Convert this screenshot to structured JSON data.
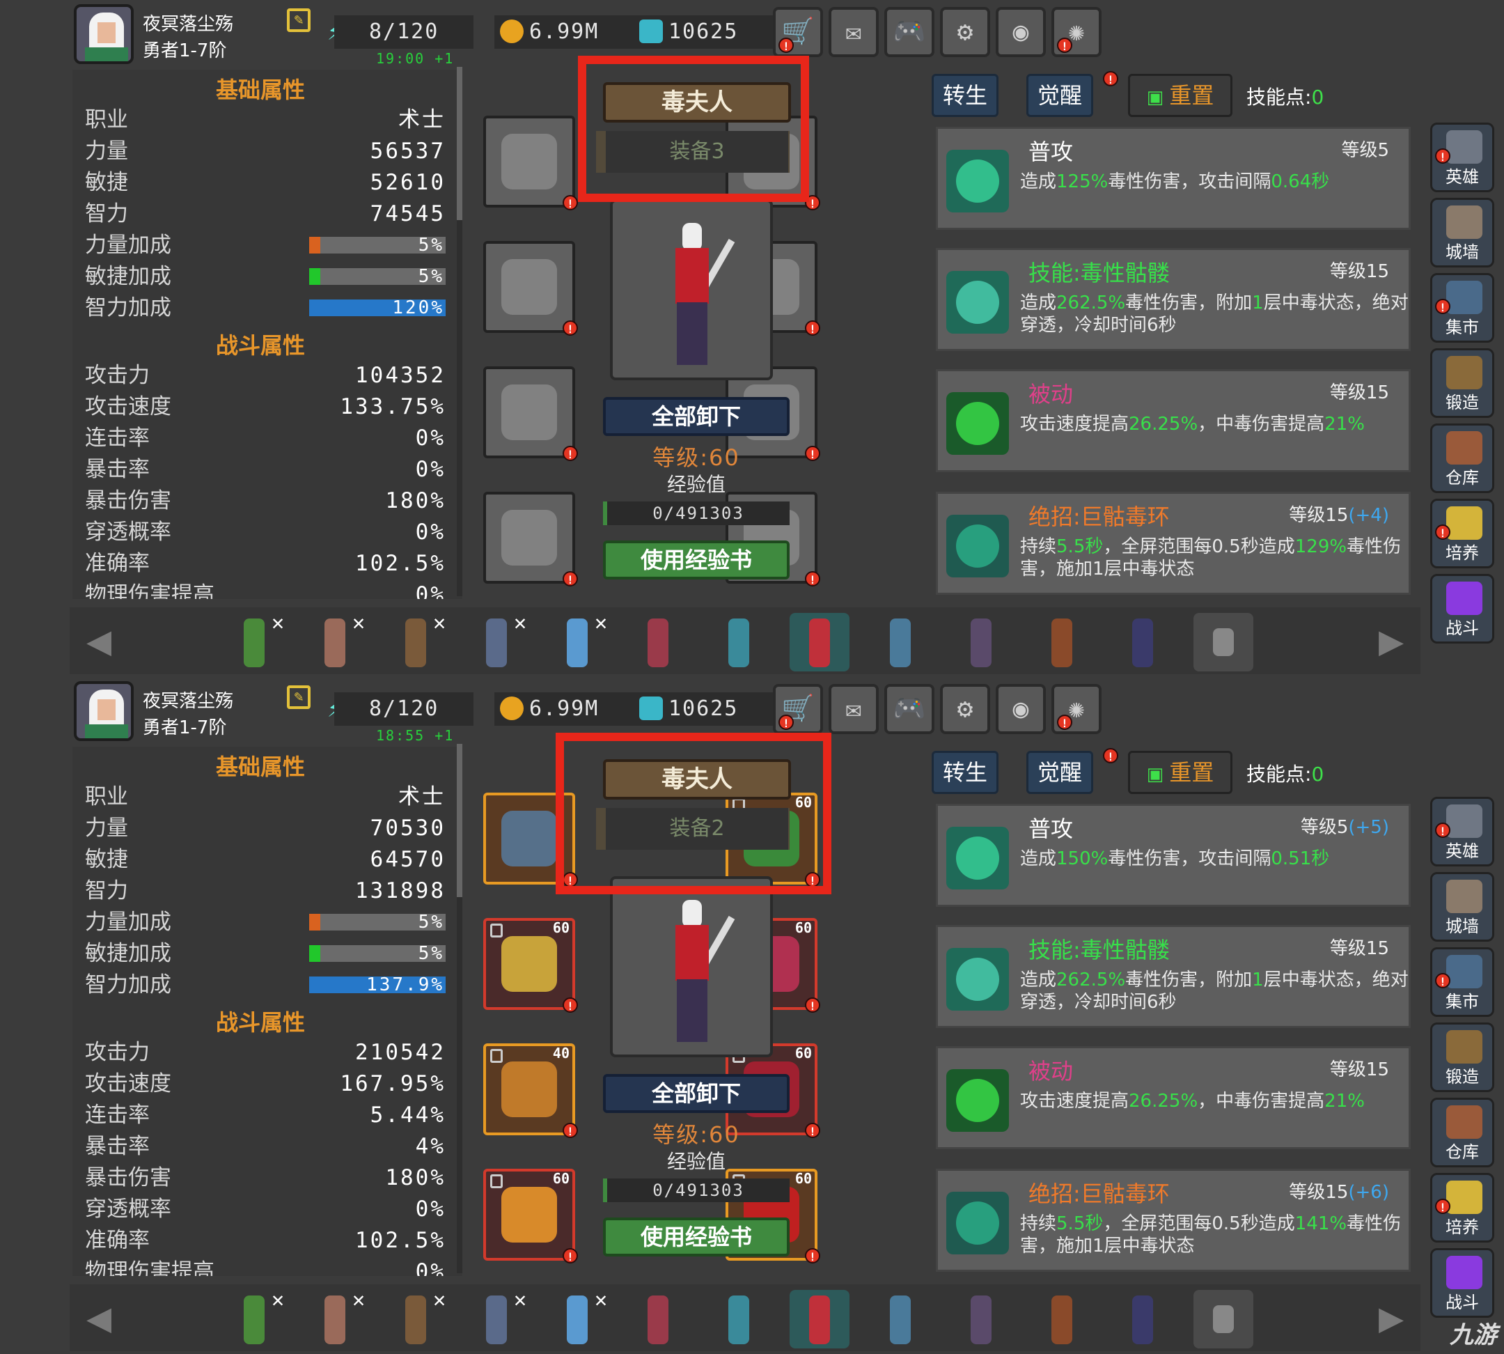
{
  "panels": [
    {
      "player": {
        "name": "夜冥落尘殇",
        "rank": "勇者1-7阶"
      },
      "stamina": "8/120",
      "gold": "6.99M",
      "gems": "10625",
      "timer": "19:00 +1",
      "basic_title": "基础属性",
      "basic": [
        {
          "label": "职业",
          "value": "术士"
        },
        {
          "label": "力量",
          "value": "56537"
        },
        {
          "label": "敏捷",
          "value": "52610"
        },
        {
          "label": "智力",
          "value": "74545"
        }
      ],
      "bonus": [
        {
          "label": "力量加成",
          "value": "5%",
          "fill": 0.05,
          "color": "#d9621f"
        },
        {
          "label": "敏捷加成",
          "value": "5%",
          "fill": 0.05,
          "color": "#21c72b"
        },
        {
          "label": "智力加成",
          "value": "120%",
          "fill": 1.0,
          "color": "#2678c9"
        }
      ],
      "combat_title": "战斗属性",
      "combat": [
        {
          "label": "攻击力",
          "value": "104352"
        },
        {
          "label": "攻击速度",
          "value": "133.75%"
        },
        {
          "label": "连击率",
          "value": "0%"
        },
        {
          "label": "暴击率",
          "value": "0%"
        },
        {
          "label": "暴击伤害",
          "value": "180%"
        },
        {
          "label": "穿透概率",
          "value": "0%"
        },
        {
          "label": "准确率",
          "value": "102.5%"
        },
        {
          "label": "物理伤害提高",
          "value": "0%"
        }
      ],
      "hero_name": "毒夫人",
      "equip_set": "装备3",
      "unequip": "全部卸下",
      "level": "等级:60",
      "exp_label": "经验值",
      "exp": "0/491303",
      "use_book": "使用经验书",
      "slot_levels": [
        "",
        "",
        "",
        "",
        "",
        "",
        "",
        ""
      ],
      "tabs": {
        "rebirth": "转生",
        "awaken": "觉醒",
        "reset": "重置",
        "skill_points_label": "技能点:",
        "skill_points": "0"
      },
      "skills": [
        {
          "name": "普攻",
          "name_color": "#ffffff",
          "level": "等级5",
          "bonus": "",
          "desc_a": "造成",
          "hl1": "125%",
          "desc_b": "毒性伤害，攻击间隔",
          "hl2": "0.64秒",
          "desc_c": ""
        },
        {
          "name": "技能:毒性骷髅",
          "name_color": "#37e04a",
          "level": "等级15",
          "bonus": "",
          "desc_a": "造成",
          "hl1": "262.5%",
          "desc_b": "毒性伤害，附加",
          "hl2": "1",
          "desc_c": "层中毒状态，绝对穿透，冷却时间6秒"
        },
        {
          "name": "被动",
          "name_color": "#e0408a",
          "level": "等级15",
          "bonus": "",
          "desc_a": "攻击速度提高",
          "hl1": "26.25%",
          "desc_b": "，中毒伤害提高",
          "hl2": "21%",
          "desc_c": ""
        },
        {
          "name": "绝招:巨骷毒环",
          "name_color": "#f07a2a",
          "level": "等级15",
          "bonus": "(+4)",
          "desc_a": "持续",
          "hl1": "5.5秒",
          "desc_b": "，全屏范围每0.5秒造成",
          "hl2": "129%",
          "desc_c": "毒性伤害，施加1层中毒状态"
        }
      ]
    },
    {
      "player": {
        "name": "夜冥落尘殇",
        "rank": "勇者1-7阶"
      },
      "stamina": "8/120",
      "gold": "6.99M",
      "gems": "10625",
      "timer": "18:55 +1",
      "basic_title": "基础属性",
      "basic": [
        {
          "label": "职业",
          "value": "术士"
        },
        {
          "label": "力量",
          "value": "70530"
        },
        {
          "label": "敏捷",
          "value": "64570"
        },
        {
          "label": "智力",
          "value": "131898"
        }
      ],
      "bonus": [
        {
          "label": "力量加成",
          "value": "5%",
          "fill": 0.05,
          "color": "#d9621f"
        },
        {
          "label": "敏捷加成",
          "value": "5%",
          "fill": 0.05,
          "color": "#21c72b"
        },
        {
          "label": "智力加成",
          "value": "137.9%",
          "fill": 1.0,
          "color": "#2678c9"
        }
      ],
      "combat_title": "战斗属性",
      "combat": [
        {
          "label": "攻击力",
          "value": "210542"
        },
        {
          "label": "攻击速度",
          "value": "167.95%"
        },
        {
          "label": "连击率",
          "value": "5.44%"
        },
        {
          "label": "暴击率",
          "value": "4%"
        },
        {
          "label": "暴击伤害",
          "value": "180%"
        },
        {
          "label": "穿透概率",
          "value": "0%"
        },
        {
          "label": "准确率",
          "value": "102.5%"
        },
        {
          "label": "物理伤害提高",
          "value": "0%"
        }
      ],
      "hero_name": "毒夫人",
      "equip_set": "装备2",
      "unequip": "全部卸下",
      "level": "等级:60",
      "exp_label": "经验值",
      "exp": "0/491303",
      "use_book": "使用经验书",
      "slot_levels": [
        "",
        "60",
        "60",
        "60",
        "40",
        "60",
        "60",
        "60"
      ],
      "tabs": {
        "rebirth": "转生",
        "awaken": "觉醒",
        "reset": "重置",
        "skill_points_label": "技能点:",
        "skill_points": "0"
      },
      "skills": [
        {
          "name": "普攻",
          "name_color": "#ffffff",
          "level": "等级5",
          "bonus": "(+5)",
          "desc_a": "造成",
          "hl1": "150%",
          "desc_b": "毒性伤害，攻击间隔",
          "hl2": "0.51秒",
          "desc_c": ""
        },
        {
          "name": "技能:毒性骷髅",
          "name_color": "#37e04a",
          "level": "等级15",
          "bonus": "",
          "desc_a": "造成",
          "hl1": "262.5%",
          "desc_b": "毒性伤害，附加",
          "hl2": "1",
          "desc_c": "层中毒状态，绝对穿透，冷却时间6秒"
        },
        {
          "name": "被动",
          "name_color": "#e0408a",
          "level": "等级15",
          "bonus": "",
          "desc_a": "攻击速度提高",
          "hl1": "26.25%",
          "desc_b": "，中毒伤害提高",
          "hl2": "21%",
          "desc_c": ""
        },
        {
          "name": "绝招:巨骷毒环",
          "name_color": "#f07a2a",
          "level": "等级15",
          "bonus": "(+6)",
          "desc_a": "持续",
          "hl1": "5.5秒",
          "desc_b": "，全屏范围每0.5秒造成",
          "hl2": "141%",
          "desc_c": "毒性伤害，施加1层中毒状态"
        }
      ]
    }
  ],
  "sidebar": [
    {
      "label": "英雄",
      "icon": "helmet-icon",
      "color": "#6f7784"
    },
    {
      "label": "城墙",
      "icon": "wall-icon",
      "color": "#8a7a6a"
    },
    {
      "label": "集市",
      "icon": "market-icon",
      "color": "#4a6a8a"
    },
    {
      "label": "锻造",
      "icon": "anvil-icon",
      "color": "#8a6a3a"
    },
    {
      "label": "仓库",
      "icon": "chest-icon",
      "color": "#9a5a3a"
    },
    {
      "label": "培养",
      "icon": "trophy-icon",
      "color": "#d4b43a"
    },
    {
      "label": "战斗",
      "icon": "portal-icon",
      "color": "#8a3adf"
    }
  ],
  "toolbar_icons": [
    "cart-icon",
    "mail-icon",
    "gamepad-icon",
    "settings-icon",
    "palette-icon",
    "fireworks-icon"
  ],
  "toolbar_glyphs": [
    "🛒",
    "✉",
    "🎮",
    "⚙",
    "◉",
    "✺"
  ],
  "heroes": [
    {
      "color": "#4a8a3a",
      "x": true
    },
    {
      "color": "#9a6a5a",
      "x": true
    },
    {
      "color": "#7a5a3a",
      "x": true
    },
    {
      "color": "#5a6a8a",
      "x": true
    },
    {
      "color": "#5a9ad0",
      "x": true
    },
    {
      "color": "#9a3a4a",
      "x": false
    },
    {
      "color": "#3a8a9a",
      "x": false
    },
    {
      "color": "#c0303a",
      "x": false
    },
    {
      "color": "#4a7a9a",
      "x": false
    },
    {
      "color": "#5a4a6a",
      "x": false
    },
    {
      "color": "#8a4a2a",
      "x": false
    },
    {
      "color": "#3a3a6a",
      "x": false
    }
  ],
  "watermark": "九游"
}
